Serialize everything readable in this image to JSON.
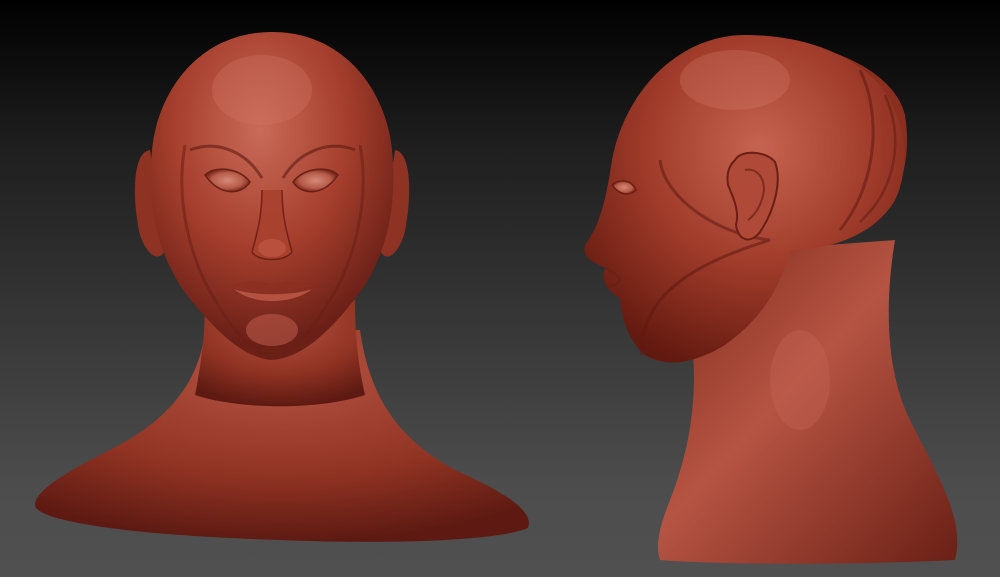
{
  "scene": {
    "description_type": "3d-sculpt-render",
    "views": [
      {
        "name": "front-view"
      },
      {
        "name": "side-view"
      }
    ],
    "colors": {
      "background_top": "#000000",
      "background_bottom": "#505050",
      "clay_base": "#a8402e",
      "clay_highlight": "#c96a58",
      "clay_shadow": "#5e1a12"
    }
  }
}
